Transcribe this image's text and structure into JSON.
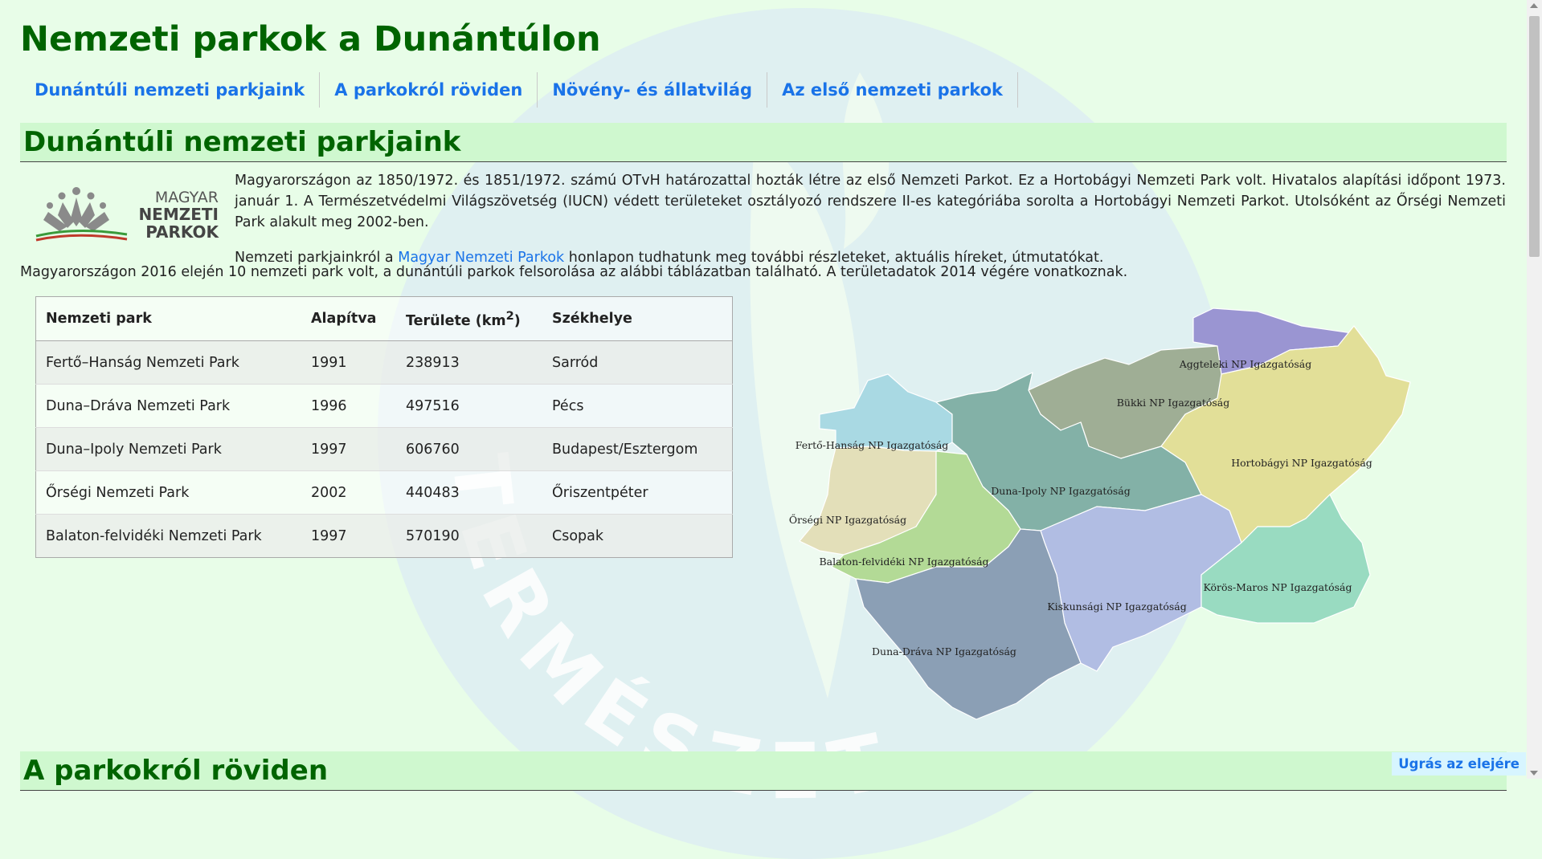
{
  "page": {
    "title": "Nemzeti parkok a Dunántúlon",
    "watermark_text": "TERMÉSZETV"
  },
  "nav": {
    "items": [
      {
        "label": "Dunántúli nemzeti parkjaink"
      },
      {
        "label": "A parkokról röviden"
      },
      {
        "label": "Növény- és állatvilág"
      },
      {
        "label": "Az első nemzeti parkok"
      }
    ]
  },
  "section1": {
    "heading": "Dunántúli nemzeti parkjaink",
    "logo": {
      "line1": "MAGYAR",
      "line2": "NEMZETI",
      "line3": "PARKOK"
    },
    "para1": "Magyarországon az 1850/1972. és 1851/1972. számú OTvH határozattal hozták létre az első Nemzeti Parkot. Ez a Hortobágyi Nemzeti Park volt. Hivatalos alapítási időpont 1973. január 1. A Természetvédelmi Világszövetség (IUCN) védett területeket osztályozó rendszere II-es kategóriába sorolta a Hortobágyi Nemzeti Parkot. Utolsóként az Őrségi Nemzeti Park alakult meg 2002-ben.",
    "para2_before": "Nemzeti parkjainkról a ",
    "para2_link": "Magyar Nemzeti Parkok",
    "para2_after": " honlapon tudhatunk meg további részleteket, aktuális híreket, útmutatókat.",
    "summary": "Magyarországon 2016 elején 10 nemzeti park volt, a dunántúli parkok felsorolása az alábbi táblázatban található. A területadatok 2014 végére vonatkoznak."
  },
  "table": {
    "headers": {
      "park": "Nemzeti park",
      "founded": "Alapítva",
      "area": "Területe (km",
      "area_sup": "2",
      "area_close": ")",
      "seat": "Székhelye"
    },
    "rows": [
      {
        "park": "Fertő–Hanság Nemzeti Park",
        "founded": "1991",
        "area": "238913",
        "seat": "Sarród"
      },
      {
        "park": "Duna–Dráva Nemzeti Park",
        "founded": "1996",
        "area": "497516",
        "seat": "Pécs"
      },
      {
        "park": "Duna–Ipoly Nemzeti Park",
        "founded": "1997",
        "area": "606760",
        "seat": "Budapest/Esztergom"
      },
      {
        "park": "Őrségi Nemzeti Park",
        "founded": "2002",
        "area": "440483",
        "seat": "Őriszentpéter"
      },
      {
        "park": "Balaton-felvidéki Nemzeti Park",
        "founded": "1997",
        "area": "570190",
        "seat": "Csopak"
      }
    ]
  },
  "map": {
    "regions": [
      {
        "label": "Aggteleki NP Igazgatóság",
        "color": "#9a95d2"
      },
      {
        "label": "Bükki NP Igazgatóság",
        "color": "#9fae95"
      },
      {
        "label": "Fertő-Hanság NP Igazgatóság",
        "color": "#a9d9e3"
      },
      {
        "label": "Hortobágyi NP Igazgatóság",
        "color": "#e2df98"
      },
      {
        "label": "Duna-Ipoly NP Igazgatóság",
        "color": "#83b1a7"
      },
      {
        "label": "Őrségi NP Igazgatóság",
        "color": "#e3dfb9"
      },
      {
        "label": "Balaton-felvidéki NP Igazgatóság",
        "color": "#b3da96"
      },
      {
        "label": "Kiskunsági NP Igazgatóság",
        "color": "#b1bde3"
      },
      {
        "label": "Körös-Maros NP Igazgatóság",
        "color": "#99dbc1"
      },
      {
        "label": "Duna-Dráva NP Igazgatóság",
        "color": "#8b9fb5"
      }
    ]
  },
  "section2": {
    "heading": "A parkokról röviden"
  },
  "back_to_top": "Ugrás az elejére"
}
